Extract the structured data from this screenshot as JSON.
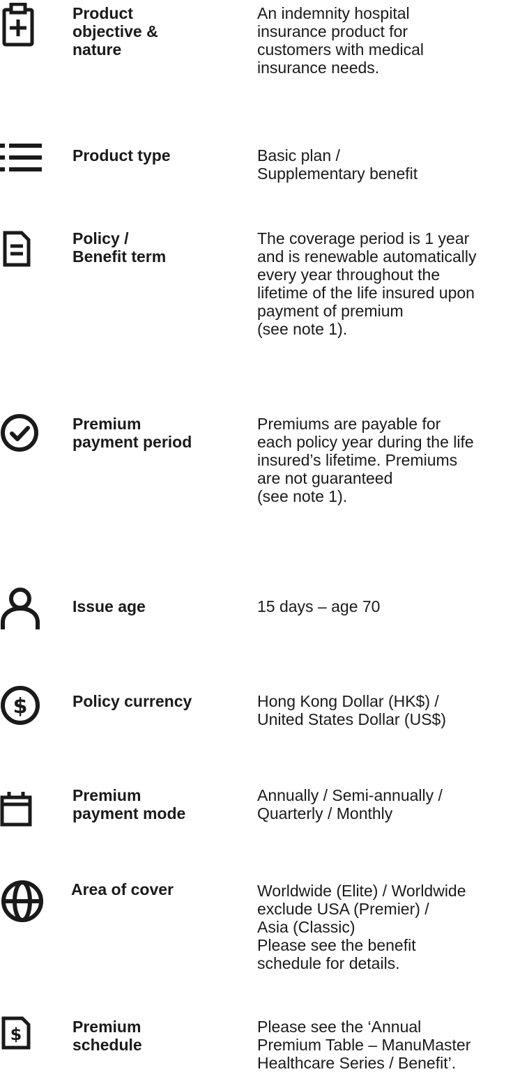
{
  "rows": [
    {
      "icon": "medical-clipboard-icon",
      "label_lines": [
        "Product",
        "objective &",
        "nature"
      ],
      "value_lines": [
        "An indemnity hospital",
        "insurance product for",
        "customers with medical",
        "insurance needs."
      ]
    },
    {
      "icon": "list-icon",
      "label_lines": [
        "Product type"
      ],
      "value_lines": [
        "Basic plan /",
        "Supplementary benefit"
      ]
    },
    {
      "icon": "document-icon",
      "label_lines": [
        "Policy /",
        "Benefit term"
      ],
      "value_lines": [
        "The coverage period is 1 year",
        "and is renewable automatically",
        "every year throughout the",
        "lifetime of the life insured upon",
        "payment of premium",
        "(see note 1)."
      ]
    },
    {
      "icon": "check-circle-icon",
      "label_lines": [
        "Premium",
        "payment period"
      ],
      "value_lines": [
        "Premiums are payable for",
        "each policy year during the life",
        "insured’s lifetime. Premiums",
        "are not guaranteed",
        "(see note 1)."
      ]
    },
    {
      "icon": "person-icon",
      "label_lines": [
        "Issue age"
      ],
      "value_lines": [
        "15 days – age 70"
      ]
    },
    {
      "icon": "dollar-circle-icon",
      "label_lines": [
        "Policy currency"
      ],
      "value_lines": [
        "Hong Kong Dollar (HK$) /",
        "United States Dollar (US$)"
      ]
    },
    {
      "icon": "calendar-icon",
      "label_lines": [
        "Premium",
        "payment mode"
      ],
      "value_lines": [
        "Annually / Semi-annually /",
        "Quarterly / Monthly"
      ]
    },
    {
      "icon": "globe-icon",
      "label_lines": [
        "Area of cover"
      ],
      "value_lines": [
        "Worldwide (Elite) / Worldwide",
        "exclude USA (Premier) /",
        "Asia (Classic)",
        "Please see the benefit",
        "schedule for details."
      ]
    },
    {
      "icon": "dollar-document-icon",
      "label_lines": [
        "Premium",
        "schedule"
      ],
      "value_lines": [
        "Please see the ‘Annual",
        "Premium Table – ManuMaster",
        "Healthcare Series / Benefit’."
      ]
    }
  ]
}
